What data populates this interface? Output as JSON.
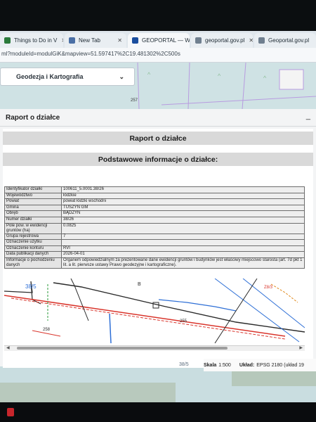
{
  "browser": {
    "tabs": [
      {
        "label": "Things to Do in V",
        "fav_color": "#2a7a3b"
      },
      {
        "label": "New Tab",
        "fav_color": "#4a6fa5"
      },
      {
        "label": "GEOPORTAL — W",
        "fav_color": "#1a4e9e"
      },
      {
        "label": "geoportal.gov.pl",
        "fav_color": "#6f7f8f"
      },
      {
        "label": "Geoportal.gov.pl",
        "fav_color": "#6f7f8f"
      }
    ],
    "url": "ml?moduleId=modulGiK&mapview=51.597417%2C19.481302%2C500s"
  },
  "map_labels": {
    "top_number": "257"
  },
  "top_dropdown": {
    "label": "Geodezja i Kartografia"
  },
  "panel": {
    "title": "Raport o działce",
    "min_symbol": "_"
  },
  "report": {
    "title": "Raport o działce",
    "subtitle": "Podstawowe informacje o działce:",
    "rows": [
      {
        "key": "Identyfikator działki",
        "value": "100611_5.0001.38/26"
      },
      {
        "key": "Województwo",
        "value": "łódzkie"
      },
      {
        "key": "Powiat",
        "value": "powiat łódzki wschodni"
      },
      {
        "key": "Gmina",
        "value": "TUSZYN GM"
      },
      {
        "key": "Obręb",
        "value": "BĄDZYN"
      },
      {
        "key": "Numer działki",
        "value": "38/26"
      },
      {
        "key": "Pole pow. w ewidencji gruntów (ha)",
        "value": "0.0825"
      },
      {
        "key": "Grupa rejestrowa",
        "value": "7"
      },
      {
        "key": "Oznaczenie użytku",
        "value": ""
      },
      {
        "key": "Oznaczenie konturu",
        "value": "RVI"
      },
      {
        "key": "Data publikacji danych",
        "value": "2026-04-01"
      },
      {
        "key": "Informacje o pochodzeniu danych",
        "value": "Organem odpowiedzialnym za prezentowane dane ewidencji gruntów i budynków jest właściwy miejscowo starosta (art. 7d pkt 1 lit. a lit. pierwsze ustawy Prawo geodezyjne i kartograficzne)."
      }
    ],
    "map_labels": {
      "parcel_left": "38/5",
      "label_b": "B",
      "label_right": "Z8/3",
      "label_mid": "255",
      "label_bottom_left": "258"
    }
  },
  "status": {
    "scale_label": "Skala",
    "scale_value": "1:500",
    "crs_label": "Układ:",
    "crs_value": "EPSG 2180 (układ 19",
    "left_number": "38/5"
  },
  "colors": {
    "accent_blue": "#1a4e9e",
    "parcel_red": "#d9342b",
    "line_blue": "#2e6fd6"
  }
}
